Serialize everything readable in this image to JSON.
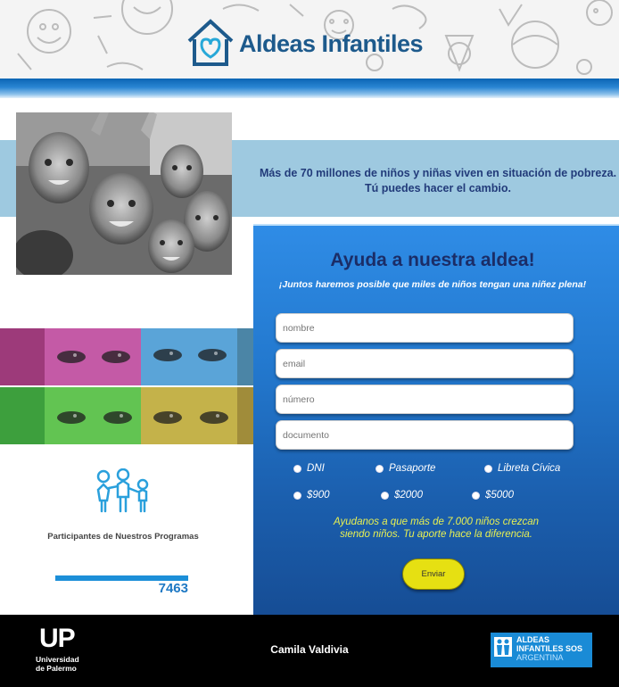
{
  "header": {
    "brand": "Aldeas Infantiles",
    "brand_color": "#1d5a8c",
    "bar_color": "#0b65b4"
  },
  "banner": {
    "line1": "Más de 70 millones de niños y niñas viven en situación de pobreza.",
    "line2": "Tú puedes hacer el cambio.",
    "background": "#9ec9e0"
  },
  "participants": {
    "icon": "children-group-icon",
    "label": "Participantes de Nuestros Programas",
    "count": "7463"
  },
  "form": {
    "title": "Ayuda a nuestra aldea!",
    "subtitle": "¡Juntos haremos posible que miles de niños tengan una niñez plena!",
    "fields": {
      "nombre": "nombre",
      "email": "email",
      "numero": "número",
      "documento": "documento"
    },
    "document_types": [
      "DNI",
      "Pasaporte",
      "Libreta Cívica"
    ],
    "amounts": [
      "$900",
      "$2000",
      "$5000"
    ],
    "message_line1": "Ayudanos a que más de 7.000 niños crezcan",
    "message_line2": "siendo niños. Tu aporte hace la diferencia.",
    "submit_label": "Enviar",
    "submit_color": "#e6e012",
    "panel_color": "#2379cf"
  },
  "footer": {
    "university_initials": "UP",
    "university_name_line1": "Universidad",
    "university_name_line2": "de Palermo",
    "author": "Camila Valdivia",
    "sos_line1": "ALDEAS",
    "sos_line2": "INFANTILES SOS",
    "sos_line3": "ARGENTINA",
    "sos_color": "#1a8bd6"
  }
}
